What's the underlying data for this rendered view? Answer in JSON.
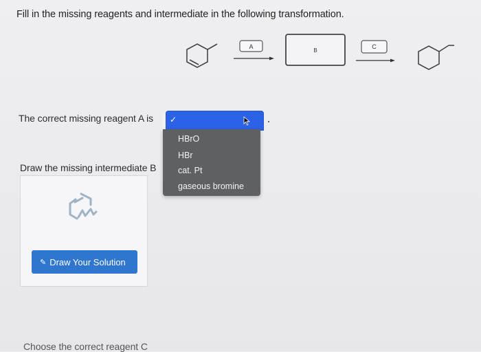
{
  "question": {
    "title": "Fill in the missing reagents and intermediate in the following transformation."
  },
  "scheme": {
    "reagent_a_label": "A",
    "intermediate_label": "B",
    "reagent_c_label": "C"
  },
  "part_a": {
    "prompt": "The correct missing reagent A is",
    "selected": "",
    "options": [
      "HBrO",
      "HBr",
      "cat. Pt",
      "gaseous bromine"
    ]
  },
  "part_b": {
    "prompt": "Draw the missing intermediate B",
    "draw_button_label": "Draw Your Solution"
  },
  "part_c": {
    "prompt": "Choose the correct reagent C"
  },
  "colors": {
    "select_highlight": "#2c63e6",
    "dropdown_bg": "#5f6063",
    "draw_button": "#2f76cf"
  },
  "icons": {
    "check": "check-icon",
    "cursor": "cursor-icon",
    "draw": "molecule-draw-icon",
    "pencil": "pencil-icon"
  }
}
